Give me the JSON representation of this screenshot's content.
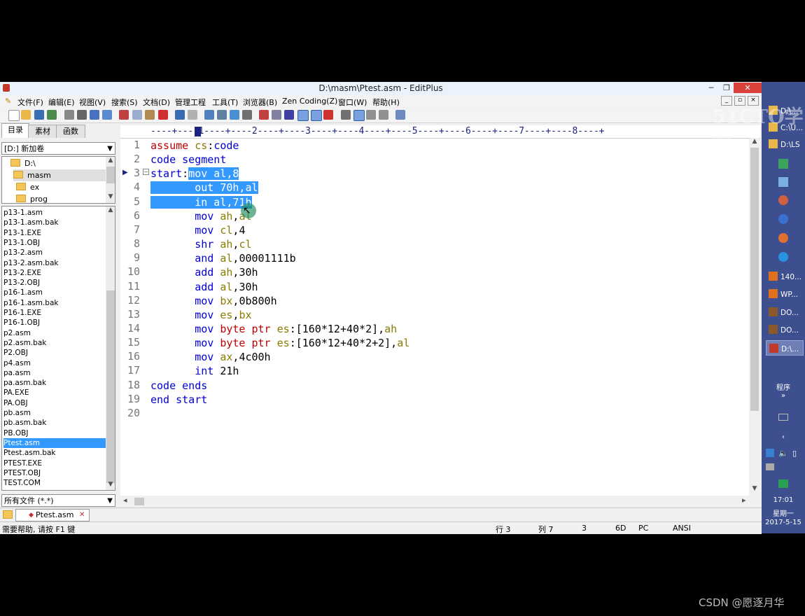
{
  "window": {
    "title": "D:\\masm\\Ptest.asm - EditPlus"
  },
  "menu": [
    "文件(F)",
    "编辑(E)",
    "视图(V)",
    "搜索(S)",
    "文档(D)",
    "管理工程",
    "工具(T)",
    "浏览器(B)",
    "Zen Coding(Z)",
    "窗口(W)",
    "帮助(H)"
  ],
  "panel": {
    "tabs": [
      "目录",
      "素材",
      "函数"
    ],
    "drive": "[D:] 新加卷",
    "tree": [
      "D:\\",
      "masm",
      "ex",
      "prog"
    ],
    "files": [
      "p13-1.asm",
      "p13-1.asm.bak",
      "P13-1.EXE",
      "P13-1.OBJ",
      "p13-2.asm",
      "p13-2.asm.bak",
      "P13-2.EXE",
      "P13-2.OBJ",
      "p16-1.asm",
      "p16-1.asm.bak",
      "P16-1.EXE",
      "P16-1.OBJ",
      "p2.asm",
      "p2.asm.bak",
      "P2.OBJ",
      "p4.asm",
      "pa.asm",
      "pa.asm.bak",
      "PA.EXE",
      "PA.OBJ",
      "pb.asm",
      "pb.asm.bak",
      "PB.OBJ",
      "Ptest.asm",
      "Ptest.asm.bak",
      "PTEST.EXE",
      "PTEST.OBJ",
      "TEST.COM"
    ],
    "selected_file": "Ptest.asm",
    "filter": "所有文件 (*.*)"
  },
  "ruler": "----+----1----+----2----+----3----+----4----+----5----+----6----+----7----+----8----+",
  "editor": {
    "line_numbers": [
      "1",
      "2",
      "3",
      "4",
      "5",
      "6",
      "7",
      "8",
      "9",
      "10",
      "11",
      "12",
      "13",
      "14",
      "15",
      "16",
      "17",
      "18",
      "19",
      "20"
    ],
    "lines": [
      "assume cs:code",
      "code segment",
      "start:mov al,8",
      "       out 70h,al",
      "       in al,71h",
      "       mov ah,al",
      "       mov cl,4",
      "       shr ah,cl",
      "       and al,00001111b",
      "       add ah,30h",
      "       add al,30h",
      "       mov bx,0b800h",
      "       mov es,bx",
      "       mov byte ptr es:[160*12+40*2],ah",
      "       mov byte ptr es:[160*12+40*2+2],al",
      "       mov ax,4c00h",
      "       int 21h",
      "code ends",
      "end start",
      ""
    ]
  },
  "doc_tab": "Ptest.asm",
  "status": {
    "help": "需要帮助, 请按 F1 键",
    "row": "行 3",
    "col": "列 7",
    "num": "3",
    "hex": "6D",
    "mode": "PC",
    "encoding": "ANSI"
  },
  "taskbar": {
    "items": [
      "D:\\...",
      "C:\\U...",
      "D:\\LS",
      "140...",
      "WP...",
      "DO...",
      "DO...",
      "D:\\..."
    ],
    "programs_label": "程序",
    "time": "17:01",
    "weekday": "星期一",
    "date": "2017-5-15"
  },
  "watermark": "51CTO学院",
  "credit": "CSDN @愿逐月华"
}
